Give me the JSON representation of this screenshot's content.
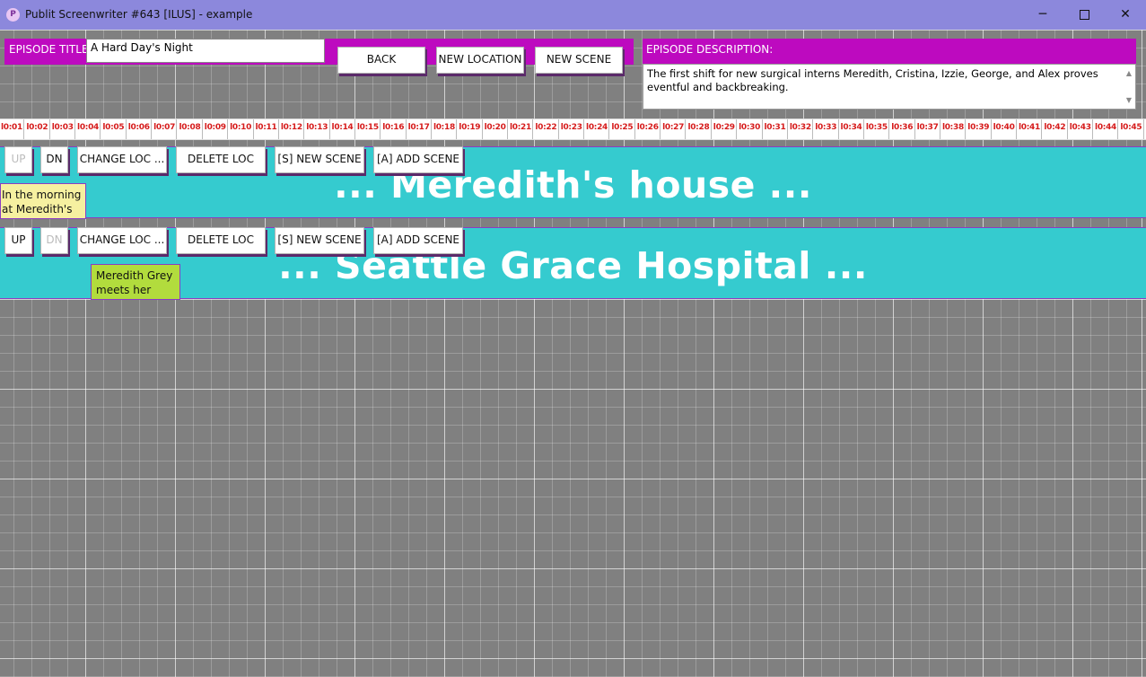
{
  "window": {
    "icon_glyph": "P",
    "title": "Publit Screenwriter #643 [ILUS] - example",
    "minimize_glyph": "─",
    "close_glyph": "✕"
  },
  "toolbar": {
    "episode_title_label": "EPISODE TITLE:",
    "episode_title_value": "A Hard Day's Night",
    "back_label": "BACK",
    "new_location_label": "NEW LOCATION",
    "new_scene_label": "NEW SCENE"
  },
  "description": {
    "label": "EPISODE DESCRIPTION:",
    "text": "The first shift for new surgical interns Meredith, Cristina, Izzie, George, and Alex proves eventful and backbreaking.",
    "scroll_up_glyph": "▲",
    "scroll_down_glyph": "▼"
  },
  "timeline": {
    "ticks": [
      "l0:01",
      "l0:02",
      "l0:03",
      "l0:04",
      "l0:05",
      "l0:06",
      "l0:07",
      "l0:08",
      "l0:09",
      "l0:10",
      "l0:11",
      "l0:12",
      "l0:13",
      "l0:14",
      "l0:15",
      "l0:16",
      "l0:17",
      "l0:18",
      "l0:19",
      "l0:20",
      "l0:21",
      "l0:22",
      "l0:23",
      "l0:24",
      "l0:25",
      "l0:26",
      "l0:27",
      "l0:28",
      "l0:29",
      "l0:30",
      "l0:31",
      "l0:32",
      "l0:33",
      "l0:34",
      "l0:35",
      "l0:36",
      "l0:37",
      "l0:38",
      "l0:39",
      "l0:40",
      "l0:41",
      "l0:42",
      "l0:43",
      "l0:44",
      "l0:45"
    ]
  },
  "row_buttons": {
    "up": "UP",
    "dn": "DN",
    "change_loc": "CHANGE LOC ...",
    "delete_loc": "DELETE LOC",
    "new_scene": "[S] NEW SCENE",
    "add_scene": "[A] ADD SCENE"
  },
  "locations": [
    {
      "title": "... Meredith's house ...",
      "up_disabled": true,
      "dn_disabled": false,
      "scenes": [
        {
          "text": "In the morning at Meredith's",
          "color": "#f6f0a0"
        }
      ]
    },
    {
      "title": "... Seattle Grace Hospital ...",
      "up_disabled": false,
      "dn_disabled": true,
      "scenes": [
        {
          "text": "Meredith Grey meets her",
          "color": "#b2dc3d"
        }
      ]
    }
  ],
  "colors": {
    "titlebar": "#8c88dc",
    "toolbar_accent": "#bd0abf",
    "location_row": "#35cbcf",
    "tick_text": "#d61c1c",
    "grid_bg": "#808080"
  }
}
